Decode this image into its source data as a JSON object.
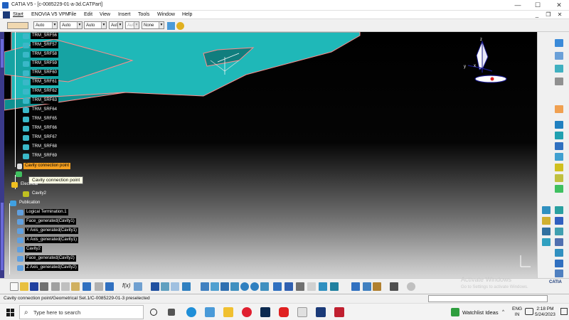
{
  "window": {
    "title": "CATIA V5 - [c-0085229-01-a-3d.CATPart]",
    "minimize": "—",
    "maximize": "☐",
    "close": "✕"
  },
  "menu": {
    "items": [
      "Start",
      "ENOVIA V5 VPM",
      "File",
      "Edit",
      "View",
      "Insert",
      "Tools",
      "Window",
      "Help"
    ],
    "mdi_min": "_",
    "mdi_restore": "❐",
    "mdi_close": "✕"
  },
  "properties_toolbar": {
    "combos": [
      "Auto",
      "Auto",
      "Auto",
      "Aut",
      "Aut",
      "None"
    ]
  },
  "tree": {
    "srf_items": [
      "TRM_SRF56",
      "TRM_SRF57",
      "TRM_SRF58",
      "TRM_SRF59",
      "TRM_SRF60",
      "TRM_SRF61",
      "TRM_SRF62",
      "TRM_SRF63",
      "TRM_SRF64",
      "TRM_SRF65",
      "TRM_SRF66",
      "TRM_SRF67",
      "TRM_SRF68",
      "TRM_SRF69"
    ],
    "cavity_connection_point": "Cavity connection point",
    "tooltip": "Cavity connection point",
    "electrical": "Electrical",
    "cavity2": "Cavity2",
    "publication": "Publication",
    "publication_items": [
      "Logical Termination.1",
      "Face_generated(Cavity1)",
      "Y Axis_generated(Cavity1)",
      "X Axis_generated(Cavity1)",
      "Cavity2",
      "Face_generated(Cavity2)",
      "Z Axis_generated(Cavity2)"
    ]
  },
  "compass": {
    "x": "x",
    "y": "y",
    "z": "z"
  },
  "bottom_toolbar": {
    "fx": "f(x)"
  },
  "watermark": {
    "line1": "Activate Windows",
    "line2": "Go to Settings to activate Windows."
  },
  "status": {
    "text": "Cavity connection point/Geometrical Set.1/C-0085229-01-3 preselected",
    "logo": "CATIA"
  },
  "taskbar": {
    "search_placeholder": "Type here to search",
    "watchlist": "Watchlist Ideas",
    "lang1": "ENG",
    "lang2": "IN",
    "time": "2:18 PM",
    "date": "5/24/2023"
  },
  "colors": {
    "part_fill": "#1fb8b8",
    "part_edge": "#ff8c8c",
    "highlight": "#f5a020",
    "tree_bg": "#000000"
  }
}
